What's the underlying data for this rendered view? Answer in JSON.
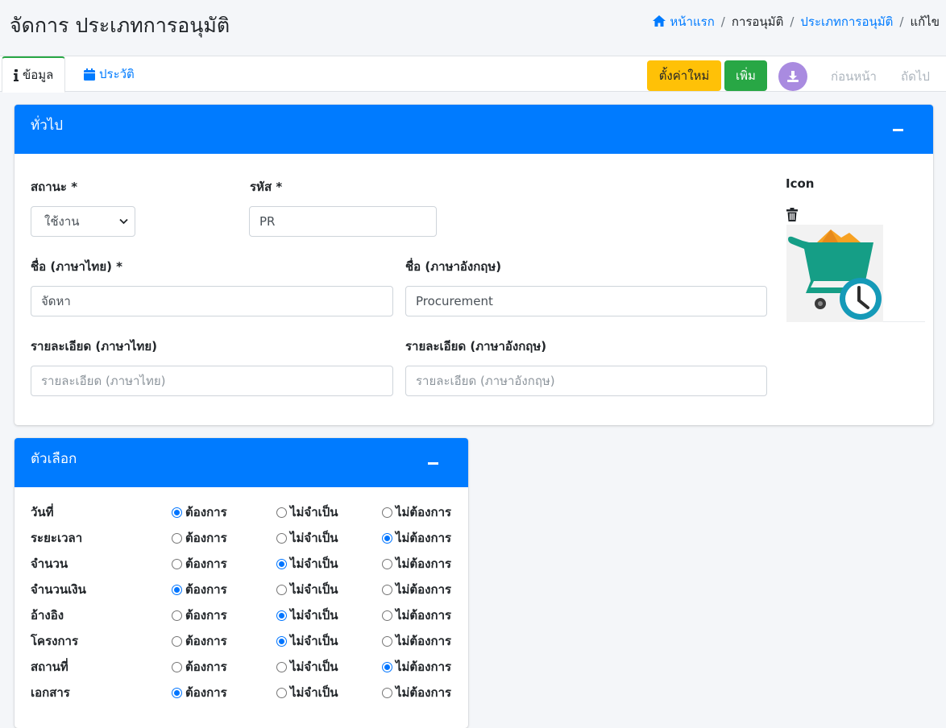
{
  "header": {
    "title_prefix": "จัดการ",
    "title_main": "ประเภทการอนุมัติ",
    "breadcrumb": {
      "home": "หน้าแรก",
      "item1": "การอนุมัติ",
      "item2": "ประเภทการอนุมัติ",
      "current": "แก้ไข"
    }
  },
  "toolbar": {
    "tab_info": "ข้อมูล",
    "tab_history": "ประวัติ",
    "reset_label": "ตั้งค่าใหม่",
    "add_label": "เพิ่ม",
    "prev_label": "ก่อนหน้า",
    "next_label": "ถัดไป"
  },
  "general": {
    "title": "ทั่วไป",
    "status_label": "สถานะ *",
    "status_value": "ใช้งาน",
    "code_label": "รหัส *",
    "code_value": "PR",
    "icon_label": "Icon",
    "name_th_label": "ชื่อ (ภาษาไทย) *",
    "name_th_value": "จัดหา",
    "name_en_label": "ชื่อ (ภาษาอังกฤษ)",
    "name_en_value": "Procurement",
    "desc_th_label": "รายละเอียด (ภาษาไทย)",
    "desc_th_placeholder": "รายละเอียด (ภาษาไทย)",
    "desc_en_label": "รายละเอียด (ภาษาอังกฤษ)",
    "desc_en_placeholder": "รายละเอียด (ภาษาอังกฤษ)"
  },
  "options": {
    "title": "ตัวเลือก",
    "choices": [
      "ต้องการ",
      "ไม่จำเป็น",
      "ไม่ต้องการ"
    ],
    "rows": [
      {
        "label": "วันที่",
        "selected": 0
      },
      {
        "label": "ระยะเวลา",
        "selected": 2
      },
      {
        "label": "จำนวน",
        "selected": 1
      },
      {
        "label": "จำนวนเงิน",
        "selected": 0
      },
      {
        "label": "อ้างอิง",
        "selected": 1
      },
      {
        "label": "โครงการ",
        "selected": 1
      },
      {
        "label": "สถานที่",
        "selected": 2
      },
      {
        "label": "เอกสาร",
        "selected": 0
      }
    ]
  },
  "colors": {
    "primary": "#007bff",
    "success": "#28a745",
    "warning": "#ffc107",
    "download": "#a98be0"
  }
}
